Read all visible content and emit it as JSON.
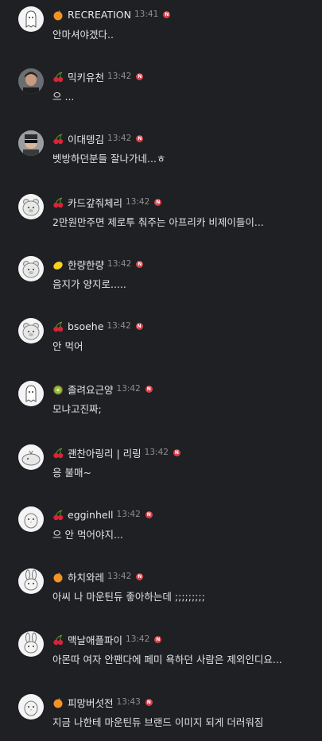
{
  "messages": [
    {
      "nickname": "RECREATION",
      "time": "13:41",
      "text": "안마셔야겠다..",
      "badge": "orange-icon",
      "avatar": "avatar-ghost"
    },
    {
      "nickname": "믹키유천",
      "time": "13:42",
      "text": "으 ...",
      "badge": "cherry-icon",
      "avatar": "avatar-photo"
    },
    {
      "nickname": "이대뎅김",
      "time": "13:42",
      "text": "벳방하던분들 잘나가네...ㅎ",
      "badge": "cherry-icon",
      "avatar": "avatar-photo2"
    },
    {
      "nickname": "카드갚줘체리",
      "time": "13:42",
      "text": "2만원만주면 제로투 춰주는 아프리카 비제이들이...",
      "badge": "cherry-icon",
      "avatar": "avatar-bear"
    },
    {
      "nickname": "한량한량",
      "time": "13:42",
      "text": "음지가 양지로.....",
      "badge": "lemon-icon",
      "avatar": "avatar-bear"
    },
    {
      "nickname": "bsoehe",
      "time": "13:42",
      "text": "안 먹어",
      "badge": "cherry-icon",
      "avatar": "avatar-bear"
    },
    {
      "nickname": "졸려요근양",
      "time": "13:42",
      "text": "모냐고진짜;",
      "badge": "kiwi-icon",
      "avatar": "avatar-ghost"
    },
    {
      "nickname": "괜찬아링리 | 리링",
      "time": "13:42",
      "text": "응 불매~",
      "badge": "cherry-icon",
      "avatar": "avatar-whale"
    },
    {
      "nickname": "egginhell",
      "time": "13:42",
      "text": "으 안 먹어야지...",
      "badge": "cherry-icon",
      "avatar": "avatar-chick"
    },
    {
      "nickname": "하치와레",
      "time": "13:42",
      "text": "아씨 나 마운틴듀 좋아하는데 ;;;;;;;;;",
      "badge": "orange-icon",
      "avatar": "avatar-rabbit"
    },
    {
      "nickname": "맥날애플파이",
      "time": "13:42",
      "text": "아몬따 여자 안팬다에 페미 욕하던 사람은 제외인디요...",
      "badge": "cherry-icon",
      "avatar": "avatar-rabbit"
    },
    {
      "nickname": "피망버섯전",
      "time": "13:43",
      "text": "지금 나한테 마운틴듀 브랜드 이미지 되게 더러워짐",
      "badge": "orange-icon",
      "avatar": "avatar-chick"
    }
  ],
  "new_marker": "N",
  "colors": {
    "background": "#1f2023",
    "new_badge": "#d8414a",
    "timestamp": "#8f8f8f"
  }
}
